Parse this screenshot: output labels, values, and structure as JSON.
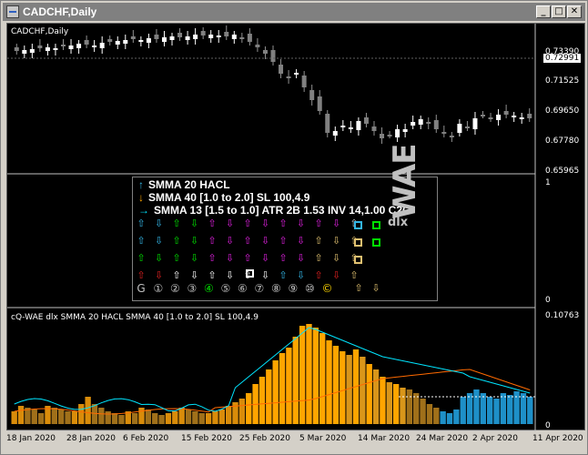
{
  "window": {
    "title": "CADCHF,Daily"
  },
  "price_panel": {
    "label": "CADCHF,Daily",
    "y_ticks": [
      "0.73390",
      "0.71525",
      "0.69650",
      "0.67780",
      "0.65965"
    ],
    "current_price": "0.72991"
  },
  "indicator_panel": {
    "scale_top": "1",
    "scale_bottom": "0",
    "legend": [
      {
        "arrow": "↑",
        "color": "#33b5e5",
        "text": "SMMA 20 HACL"
      },
      {
        "arrow": "↓",
        "color": "#ffa500",
        "text": "SMMA 40 [1.0 to 2.0] SL 100,4.9"
      },
      {
        "arrow": "→",
        "color": "#00e5ff",
        "text": "SMMA 13 [1.5 to 1.0] ATR 2B 1.53 INV 14,1.00 C2C"
      }
    ],
    "watermark": {
      "brand": "WAE",
      "sub": "dlx"
    },
    "bottom_row": [
      "G",
      "①",
      "②",
      "③",
      "④",
      "⑤",
      "⑥",
      "⑦",
      "⑧",
      "⑨",
      "⑩",
      "©"
    ]
  },
  "wae_panel": {
    "label": "cQ-WAE dlx SMMA 20 HACL SMMA 40 [1.0 to 2.0] SL 100,4.9",
    "scale_top": "0.10763",
    "scale_bottom": "0"
  },
  "x_axis": {
    "labels": [
      "18 Jan 2020",
      "28 Jan 2020",
      "6 Feb 2020",
      "15 Feb 2020",
      "25 Feb 2020",
      "5 Mar 2020",
      "14 Mar 2020",
      "24 Mar 2020",
      "2 Apr 2020",
      "11 Apr 2020"
    ]
  },
  "colors": {
    "bull": "#ffffff",
    "bear": "#808080",
    "histo_up": "#ffa500",
    "histo_dn": "#b8860b",
    "histo_blue": "#1e90c8",
    "line_cyan": "#00e5ff",
    "line_orange": "#ff6a00"
  }
}
